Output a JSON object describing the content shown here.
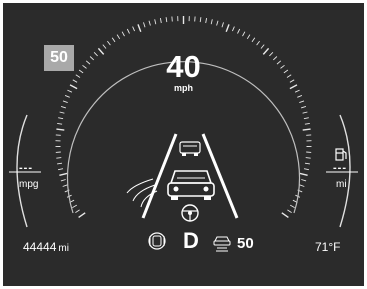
{
  "speed_limit_sign": "50",
  "speed": {
    "value": "40",
    "unit": "mph"
  },
  "fuel_economy": {
    "value": "---",
    "unit": "mpg"
  },
  "range": {
    "value": "---",
    "unit": "mi"
  },
  "odometer": {
    "value": "44444",
    "unit": "mi"
  },
  "outside_temperature": "71°F",
  "gear": "D",
  "adaptive_cruise": {
    "set_speed": "50"
  },
  "icons": [
    "fuel-pump-icon",
    "lane-keep-assist-icon",
    "following-vehicle-icon",
    "host-vehicle-icon",
    "steering-wheel-icon",
    "distance-setting-icon",
    "adaptive-cruise-icon"
  ],
  "colors": {
    "background": "#2b2b2b",
    "foreground": "#ffffff",
    "speed_limit_sign": "#a9a9a9"
  }
}
